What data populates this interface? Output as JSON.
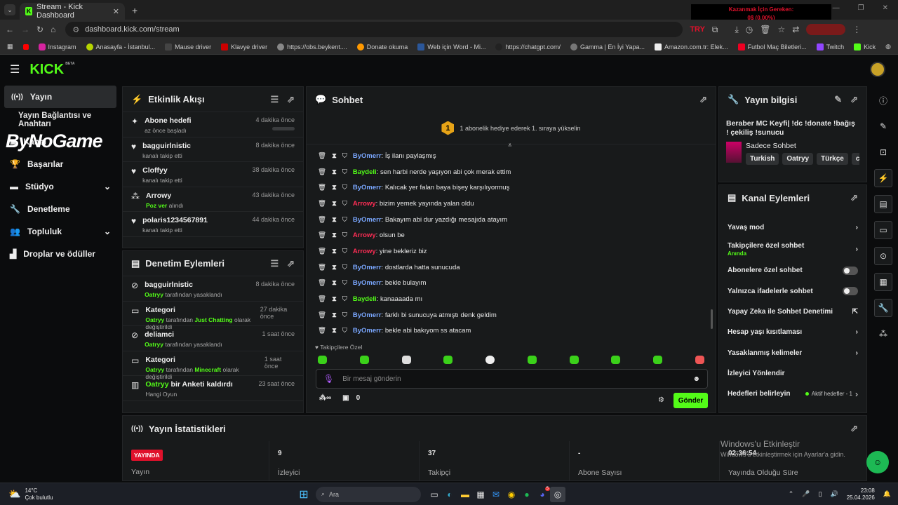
{
  "browser": {
    "tab_title": "Stream - Kick Dashboard",
    "url": "dashboard.kick.com/stream",
    "overlay_line1": "Kazanmak İçin Gereken:",
    "overlay_line2": "0$ (0.00%)",
    "overlay_tag": "TRY",
    "bookmarks": [
      "Instagram",
      "Anasayfa - İstanbul...",
      "Mause driver",
      "Klavye driver",
      "https://obs.beykent....",
      "Donate okuma",
      "Web için Word - Mi...",
      "https://chatgpt.com/",
      "Gamma | En İyi Yapa...",
      "Amazon.com.tr: Elek...",
      "Futbol Maç Biletleri...",
      "Twitch",
      "Kick"
    ]
  },
  "header": {
    "logo": "KICK",
    "beta": "BETA"
  },
  "sidebar": {
    "watermark": "ByNoGame",
    "items": [
      {
        "label": "Yayın"
      },
      {
        "label": "Yayın Bağlantısı ve Anahtarı"
      },
      {
        "label": "Kanal"
      },
      {
        "label": "Başarılar"
      },
      {
        "label": "Stüdyo"
      },
      {
        "label": "Denetleme"
      },
      {
        "label": "Topluluk"
      },
      {
        "label": "Droplar ve ödüller"
      }
    ]
  },
  "activity": {
    "title": "Etkinlik Akışı",
    "events": [
      {
        "name": "Abone hedefi",
        "detail": "az önce başladı",
        "time": "4 dakika önce"
      },
      {
        "name": "bagguirlnistic",
        "detail": "kanalı takip etti",
        "time": "8 dakika önce"
      },
      {
        "name": "Cloffyy",
        "detail": "kanalı takip etti",
        "time": "38 dakika önce"
      },
      {
        "name": "Arrowy",
        "detail_green": "Poz ver",
        "detail": "alındı",
        "time": "43 dakika önce"
      },
      {
        "name": "polaris1234567891",
        "detail": "kanalı takip etti",
        "time": "44 dakika önce"
      }
    ]
  },
  "moderation": {
    "title": "Denetim Eylemleri",
    "events": [
      {
        "name": "bagguirlnistic",
        "actor": "Oatryy",
        "detail": "tarafından yasaklandı",
        "time": "8 dakika önce"
      },
      {
        "name": "Kategori",
        "actor": "Oatryy",
        "mid": "tarafından",
        "value": "Just Chatting",
        "detail": "olarak değiştirildi",
        "time": "27 dakika önce"
      },
      {
        "name": "deliamci",
        "actor": "Oatryy",
        "detail": "tarafından yasaklandı",
        "time": "1 saat önce"
      },
      {
        "name": "Kategori",
        "actor": "Oatryy",
        "mid": "tarafından",
        "value": "Minecraft",
        "detail": "olarak değiştirildi",
        "time": "1 saat önce"
      },
      {
        "name_green": "Oatryy",
        "name": "bir Anketi kaldırdı",
        "detail": "Hangi Oyun",
        "time": "23 saat önce"
      }
    ]
  },
  "chat": {
    "title": "Sohbet",
    "sub_rank": "1",
    "sub_banner": "1 abonelik hediye ederek 1. sıraya yükselin",
    "messages": [
      {
        "user": "ByOmerr",
        "color": "#7aa7ff",
        "text": ": İş ilanı paylaşmış"
      },
      {
        "user": "Baydeli",
        "color": "#53fc18",
        "text": ": sen harbi nerde yaşıyon abi çok merak ettim"
      },
      {
        "user": "ByOmerr",
        "color": "#7aa7ff",
        "text": ": Kalıcak yer falan baya bişey karşılıyormuş"
      },
      {
        "user": "Arrowy",
        "color": "#ff2d55",
        "text": ": bizim yemek yayında yalan oldu"
      },
      {
        "user": "ByOmerr",
        "color": "#7aa7ff",
        "text": ": Bakayım abi dur yazdığı mesajıda atayım"
      },
      {
        "user": "Arrowy",
        "color": "#ff2d55",
        "text": ": olsun be"
      },
      {
        "user": "Arrowy",
        "color": "#ff2d55",
        "text": ": yine bekleriz biz"
      },
      {
        "user": "ByOmerr",
        "color": "#7aa7ff",
        "text": ": dostlarda hatta sunucuda"
      },
      {
        "user": "ByOmerr",
        "color": "#7aa7ff",
        "text": ": bekle bulayım"
      },
      {
        "user": "Baydeli",
        "color": "#53fc18",
        "text": ": kanaaaada mı"
      },
      {
        "user": "ByOmerr",
        "color": "#7aa7ff",
        "text": ": farklı bi sunucuya atmıştı denk geldim"
      },
      {
        "user": "ByOmerr",
        "color": "#7aa7ff",
        "text": ": bekle abi bakıyom ss atacam"
      }
    ],
    "followers_only": "Takipçilere Özel",
    "input_placeholder": "Bir mesaj gönderin",
    "points": "0",
    "send_label": "Gönder"
  },
  "stream_info": {
    "title": "Yayın bilgisi",
    "stream_title": "Beraber MC Keyfi| !dc !donate !bağış ! çekiliş !sunucu",
    "category": "Sadece Sohbet",
    "tags": [
      "Turkish",
      "Oatryy",
      "Türkçe",
      "chil"
    ]
  },
  "channel_actions": {
    "title": "Kanal Eylemleri",
    "rows": [
      {
        "label": "Yavaş mod",
        "type": "chevron"
      },
      {
        "label": "Takipçilere özel sohbet",
        "sub": "Anında",
        "type": "chevron"
      },
      {
        "label": "Abonelere özel sohbet",
        "type": "toggle"
      },
      {
        "label": "Yalnızca ifadelerle sohbet",
        "type": "toggle"
      },
      {
        "label": "Yapay Zeka ile Sohbet Denetimi",
        "type": "external"
      },
      {
        "label": "Hesap yaşı kısıtlaması",
        "type": "chevron"
      },
      {
        "label": "Yasaklanmış kelimeler",
        "type": "chevron"
      },
      {
        "label": "İzleyici Yönlendir",
        "type": "none"
      },
      {
        "label": "Hedefleri belirleyin",
        "extra": "Aktif hedefler - 1",
        "type": "chevron"
      }
    ]
  },
  "stats": {
    "title": "Yayın İstatistikleri",
    "live_badge": "YAYINDA",
    "items": [
      {
        "label": "Yayın"
      },
      {
        "value": "9",
        "label": "İzleyici"
      },
      {
        "value": "37",
        "label": "Takipçi"
      },
      {
        "value": "-",
        "label": "Abone Sayısı"
      },
      {
        "value": "02:36:54",
        "label": "Yayında Olduğu Süre"
      }
    ],
    "activation_title": "Windows'u Etkinleştir",
    "activation_sub": "Windows'u etkinleştirmek için Ayarlar'a gidin."
  },
  "taskbar": {
    "weather_temp": "14°C",
    "weather_desc": "Çok bulutlu",
    "search_placeholder": "Ara",
    "time": "23:08",
    "date": "25.04.2026",
    "discord_badge": "5"
  },
  "colors": {
    "accent": "#53fc18",
    "panel": "#181a1b",
    "live": "#e0112b"
  }
}
